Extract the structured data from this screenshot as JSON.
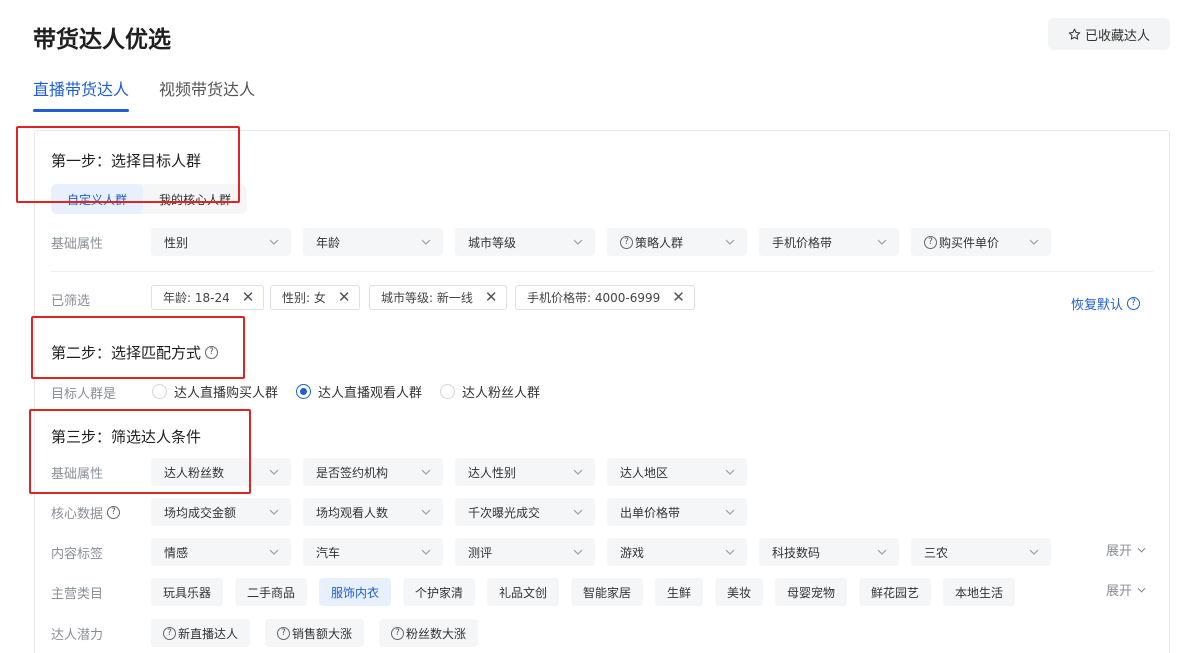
{
  "header": {
    "title": "带货达人优选",
    "favorite_label": "已收藏达人"
  },
  "tabs": [
    {
      "label": "直播带货达人",
      "active": true
    },
    {
      "label": "视频带货达人",
      "active": false
    }
  ],
  "step1": {
    "title": "第一步：选择目标人群",
    "segments": [
      {
        "label": "自定义人群",
        "active": true
      },
      {
        "label": "我的核心人群",
        "active": false
      }
    ],
    "basic_label": "基础属性",
    "selects": [
      {
        "label": "性别",
        "help": false
      },
      {
        "label": "年龄",
        "help": false
      },
      {
        "label": "城市等级",
        "help": false
      },
      {
        "label": "策略人群",
        "help": true
      },
      {
        "label": "手机价格带",
        "help": false
      },
      {
        "label": "购买件单价",
        "help": true
      }
    ],
    "filtered_label": "已筛选",
    "chips": [
      "年龄: 18-24",
      "性别: 女",
      "城市等级: 新一线",
      "手机价格带: 4000-6999"
    ],
    "restore_label": "恢复默认"
  },
  "step2": {
    "title": "第二步：选择匹配方式",
    "target_label": "目标人群是",
    "options": [
      {
        "label": "达人直播购买人群",
        "checked": false
      },
      {
        "label": "达人直播观看人群",
        "checked": true
      },
      {
        "label": "达人粉丝人群",
        "checked": false
      }
    ]
  },
  "step3": {
    "title": "第三步：筛选达人条件",
    "basic_label": "基础属性",
    "basic_selects": [
      "达人粉丝数",
      "是否签约机构",
      "达人性别",
      "达人地区"
    ],
    "core_label": "核心数据",
    "core_selects": [
      "场均成交金额",
      "场均观看人数",
      "千次曝光成交",
      "出单价格带"
    ],
    "content_label": "内容标签",
    "content_selects": [
      "情感",
      "汽车",
      "测评",
      "游戏",
      "科技数码",
      "三农"
    ],
    "expand_label": "展开",
    "category_label": "主营类目",
    "categories": [
      {
        "label": "玩具乐器",
        "active": false
      },
      {
        "label": "二手商品",
        "active": false
      },
      {
        "label": "服饰内衣",
        "active": true
      },
      {
        "label": "个护家清",
        "active": false
      },
      {
        "label": "礼品文创",
        "active": false
      },
      {
        "label": "智能家居",
        "active": false
      },
      {
        "label": "生鲜",
        "active": false
      },
      {
        "label": "美妆",
        "active": false
      },
      {
        "label": "母婴宠物",
        "active": false
      },
      {
        "label": "鲜花园艺",
        "active": false
      },
      {
        "label": "本地生活",
        "active": false
      }
    ],
    "potential_label": "达人潜力",
    "potentials": [
      "新直播达人",
      "销售额大涨",
      "粉丝数大涨"
    ]
  },
  "icons": {
    "favorite": "star-outline-icon",
    "dropdown": "chevron-down-icon",
    "help": "question-circle-icon",
    "remove": "close-icon"
  },
  "colors": {
    "accent": "#1f5dd6",
    "annotation": "#e02424"
  }
}
